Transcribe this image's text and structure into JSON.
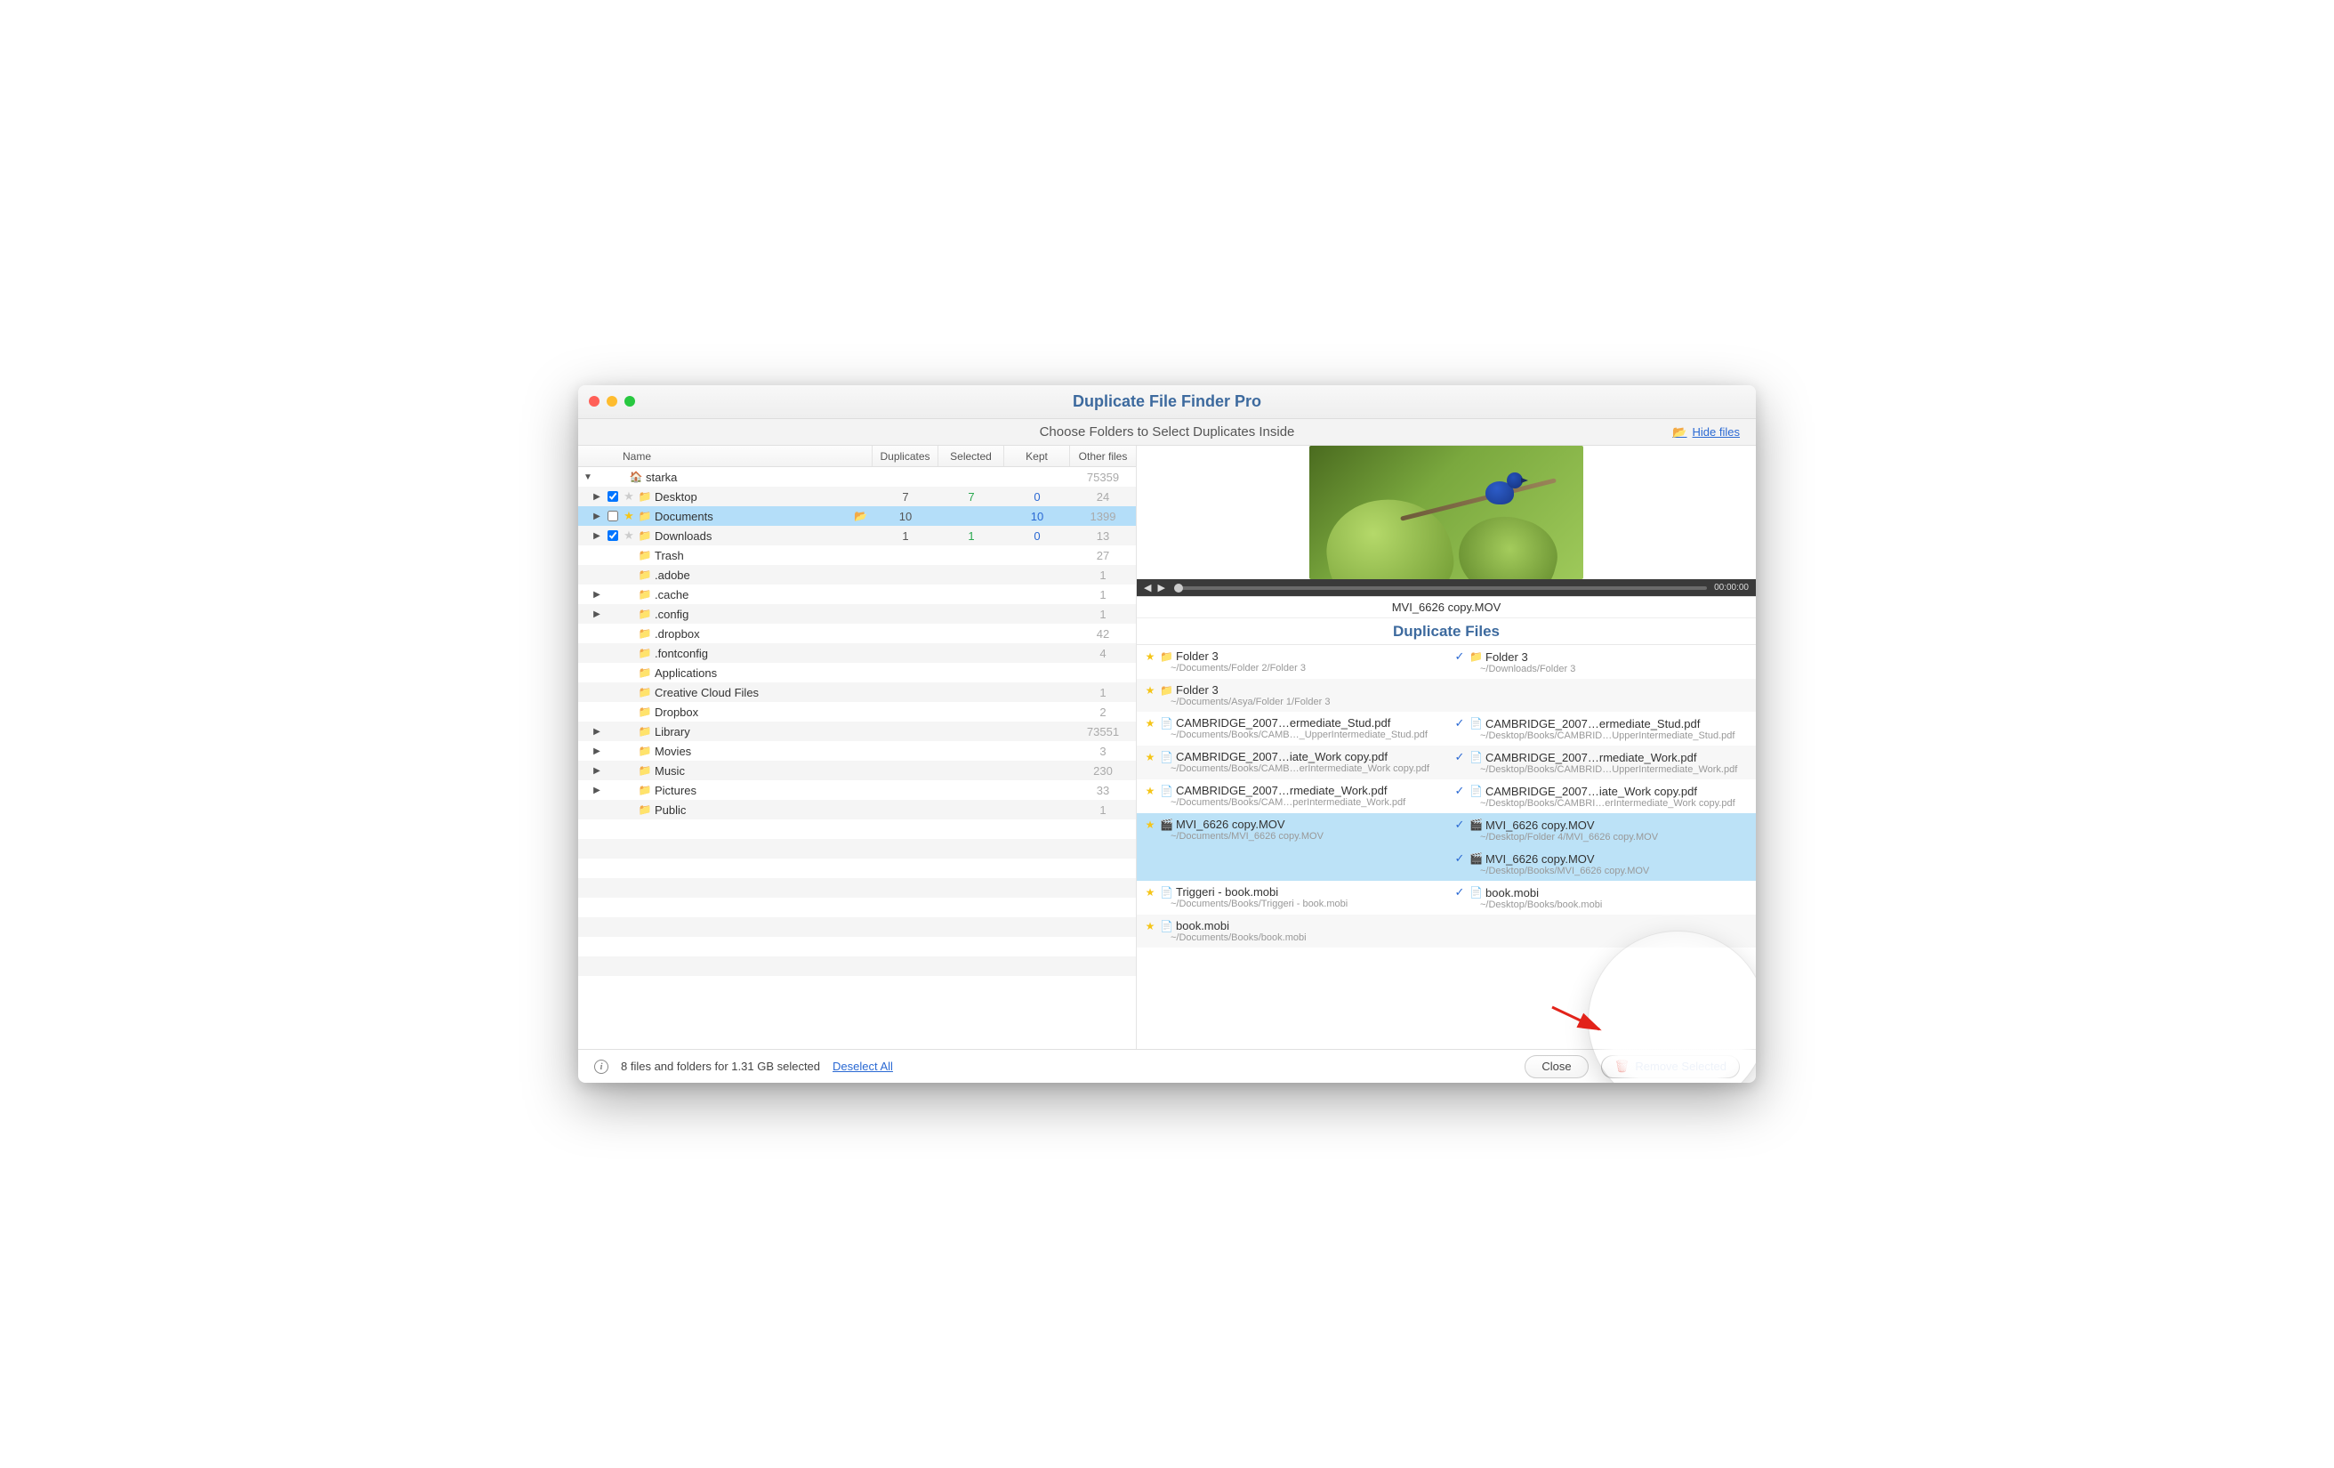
{
  "window": {
    "title": "Duplicate File Finder Pro"
  },
  "subheader": {
    "text": "Choose Folders to Select Duplicates Inside",
    "hide_files": "Hide files"
  },
  "columns": {
    "name": "Name",
    "duplicates": "Duplicates",
    "selected": "Selected",
    "kept": "Kept",
    "other": "Other files"
  },
  "tree": [
    {
      "name": "starka",
      "indent": 0,
      "expandable": true,
      "expanded": true,
      "icon": "home",
      "other": "75359"
    },
    {
      "name": "Desktop",
      "indent": 1,
      "expandable": true,
      "checkbox": true,
      "checked": true,
      "star": "off",
      "icon": "folder",
      "dup": "7",
      "sel": "7",
      "selcolor": "green",
      "kept": "0",
      "keptcolor": "blue",
      "other": "24"
    },
    {
      "name": "Documents",
      "indent": 1,
      "expandable": true,
      "checkbox": true,
      "checked": false,
      "star": "on",
      "icon": "folder",
      "open": true,
      "dup": "10",
      "sel": "",
      "kept": "10",
      "keptcolor": "blue",
      "other": "1399",
      "selected": true
    },
    {
      "name": "Downloads",
      "indent": 1,
      "expandable": true,
      "checkbox": true,
      "checked": true,
      "star": "off",
      "icon": "folder",
      "dup": "1",
      "sel": "1",
      "selcolor": "green",
      "kept": "0",
      "keptcolor": "blue",
      "other": "13"
    },
    {
      "name": "Trash",
      "indent": 1,
      "spacer": true,
      "icon": "folder",
      "other": "27"
    },
    {
      "name": ".adobe",
      "indent": 1,
      "spacer": true,
      "icon": "folder",
      "other": "1"
    },
    {
      "name": ".cache",
      "indent": 1,
      "expandable": true,
      "spacer": true,
      "icon": "folder",
      "other": "1"
    },
    {
      "name": ".config",
      "indent": 1,
      "expandable": true,
      "spacer": true,
      "icon": "folder",
      "other": "1"
    },
    {
      "name": ".dropbox",
      "indent": 1,
      "spacer": true,
      "icon": "folder",
      "other": "42"
    },
    {
      "name": ".fontconfig",
      "indent": 1,
      "spacer": true,
      "icon": "folder",
      "other": "4"
    },
    {
      "name": "Applications",
      "indent": 1,
      "spacer": true,
      "icon": "folder",
      "other": ""
    },
    {
      "name": "Creative Cloud Files",
      "indent": 1,
      "spacer": true,
      "icon": "folder",
      "other": "1"
    },
    {
      "name": "Dropbox",
      "indent": 1,
      "spacer": true,
      "icon": "folder",
      "other": "2"
    },
    {
      "name": "Library",
      "indent": 1,
      "expandable": true,
      "spacer": true,
      "icon": "folder",
      "other": "73551"
    },
    {
      "name": "Movies",
      "indent": 1,
      "expandable": true,
      "spacer": true,
      "icon": "folder",
      "other": "3"
    },
    {
      "name": "Music",
      "indent": 1,
      "expandable": true,
      "spacer": true,
      "icon": "folder",
      "other": "230"
    },
    {
      "name": "Pictures",
      "indent": 1,
      "expandable": true,
      "spacer": true,
      "icon": "folder",
      "other": "33"
    },
    {
      "name": "Public",
      "indent": 1,
      "spacer": true,
      "icon": "folder",
      "other": "1"
    },
    {
      "name": "",
      "blank": true
    },
    {
      "name": "",
      "blank": true
    },
    {
      "name": "",
      "blank": true
    },
    {
      "name": "",
      "blank": true
    },
    {
      "name": "",
      "blank": true
    },
    {
      "name": "",
      "blank": true
    },
    {
      "name": "",
      "blank": true
    },
    {
      "name": "",
      "blank": true
    },
    {
      "name": "",
      "blank": true
    }
  ],
  "preview": {
    "filename": "MVI_6626 copy.MOV",
    "time": "00:00:00"
  },
  "duplicates_header": "Duplicate Files",
  "duplicates": [
    {
      "left": {
        "mark": "star",
        "icon": "folder",
        "name": "Folder 3",
        "path": "~/Documents/Folder 2/Folder 3"
      },
      "right": {
        "mark": "check",
        "icon": "folder",
        "name": "Folder 3",
        "path": "~/Downloads/Folder 3"
      }
    },
    {
      "left": {
        "mark": "star",
        "icon": "folder",
        "name": "Folder 3",
        "path": "~/Documents/Asya/Folder 1/Folder 3"
      },
      "right": null,
      "alt": true
    },
    {
      "left": {
        "mark": "star",
        "icon": "pdf",
        "name": "CAMBRIDGE_2007…ermediate_Stud.pdf",
        "path": "~/Documents/Books/CAMB…_UpperIntermediate_Stud.pdf"
      },
      "right": {
        "mark": "check",
        "icon": "pdf",
        "name": "CAMBRIDGE_2007…ermediate_Stud.pdf",
        "path": "~/Desktop/Books/CAMBRID…UpperIntermediate_Stud.pdf"
      }
    },
    {
      "left": {
        "mark": "star",
        "icon": "pdf",
        "name": "CAMBRIDGE_2007…iate_Work copy.pdf",
        "path": "~/Documents/Books/CAMB…erIntermediate_Work copy.pdf"
      },
      "right": {
        "mark": "check",
        "icon": "pdf",
        "name": "CAMBRIDGE_2007…rmediate_Work.pdf",
        "path": "~/Desktop/Books/CAMBRID…UpperIntermediate_Work.pdf"
      },
      "alt": true
    },
    {
      "left": {
        "mark": "star",
        "icon": "pdf",
        "name": "CAMBRIDGE_2007…rmediate_Work.pdf",
        "path": "~/Documents/Books/CAM…perIntermediate_Work.pdf"
      },
      "right": {
        "mark": "check",
        "icon": "pdf",
        "name": "CAMBRIDGE_2007…iate_Work copy.pdf",
        "path": "~/Desktop/Books/CAMBRI…erIntermediate_Work copy.pdf"
      }
    },
    {
      "left": {
        "mark": "star",
        "icon": "mov",
        "name": "MVI_6626 copy.MOV",
        "path": "~/Documents/MVI_6626 copy.MOV"
      },
      "right": {
        "mark": "check",
        "icon": "mov",
        "name": "MVI_6626 copy.MOV",
        "path": "~/Desktop/Folder 4/MVI_6626 copy.MOV"
      },
      "hl": true
    },
    {
      "left": null,
      "right": {
        "mark": "check",
        "icon": "mov",
        "name": "MVI_6626 copy.MOV",
        "path": "~/Desktop/Books/MVI_6626 copy.MOV"
      },
      "hl": true
    },
    {
      "left": {
        "mark": "star",
        "icon": "pdf",
        "name": "Triggeri - book.mobi",
        "path": "~/Documents/Books/Triggeri - book.mobi"
      },
      "right": {
        "mark": "check",
        "icon": "pdf",
        "name": "book.mobi",
        "path": "~/Desktop/Books/book.mobi"
      }
    },
    {
      "left": {
        "mark": "star",
        "icon": "pdf",
        "name": "book.mobi",
        "path": "~/Documents/Books/book.mobi"
      },
      "right": null,
      "alt": true
    }
  ],
  "footer": {
    "info": "8 files and folders for 1.31 GB selected",
    "deselect": "Deselect All",
    "close": "Close",
    "remove": "Remove Selected"
  }
}
